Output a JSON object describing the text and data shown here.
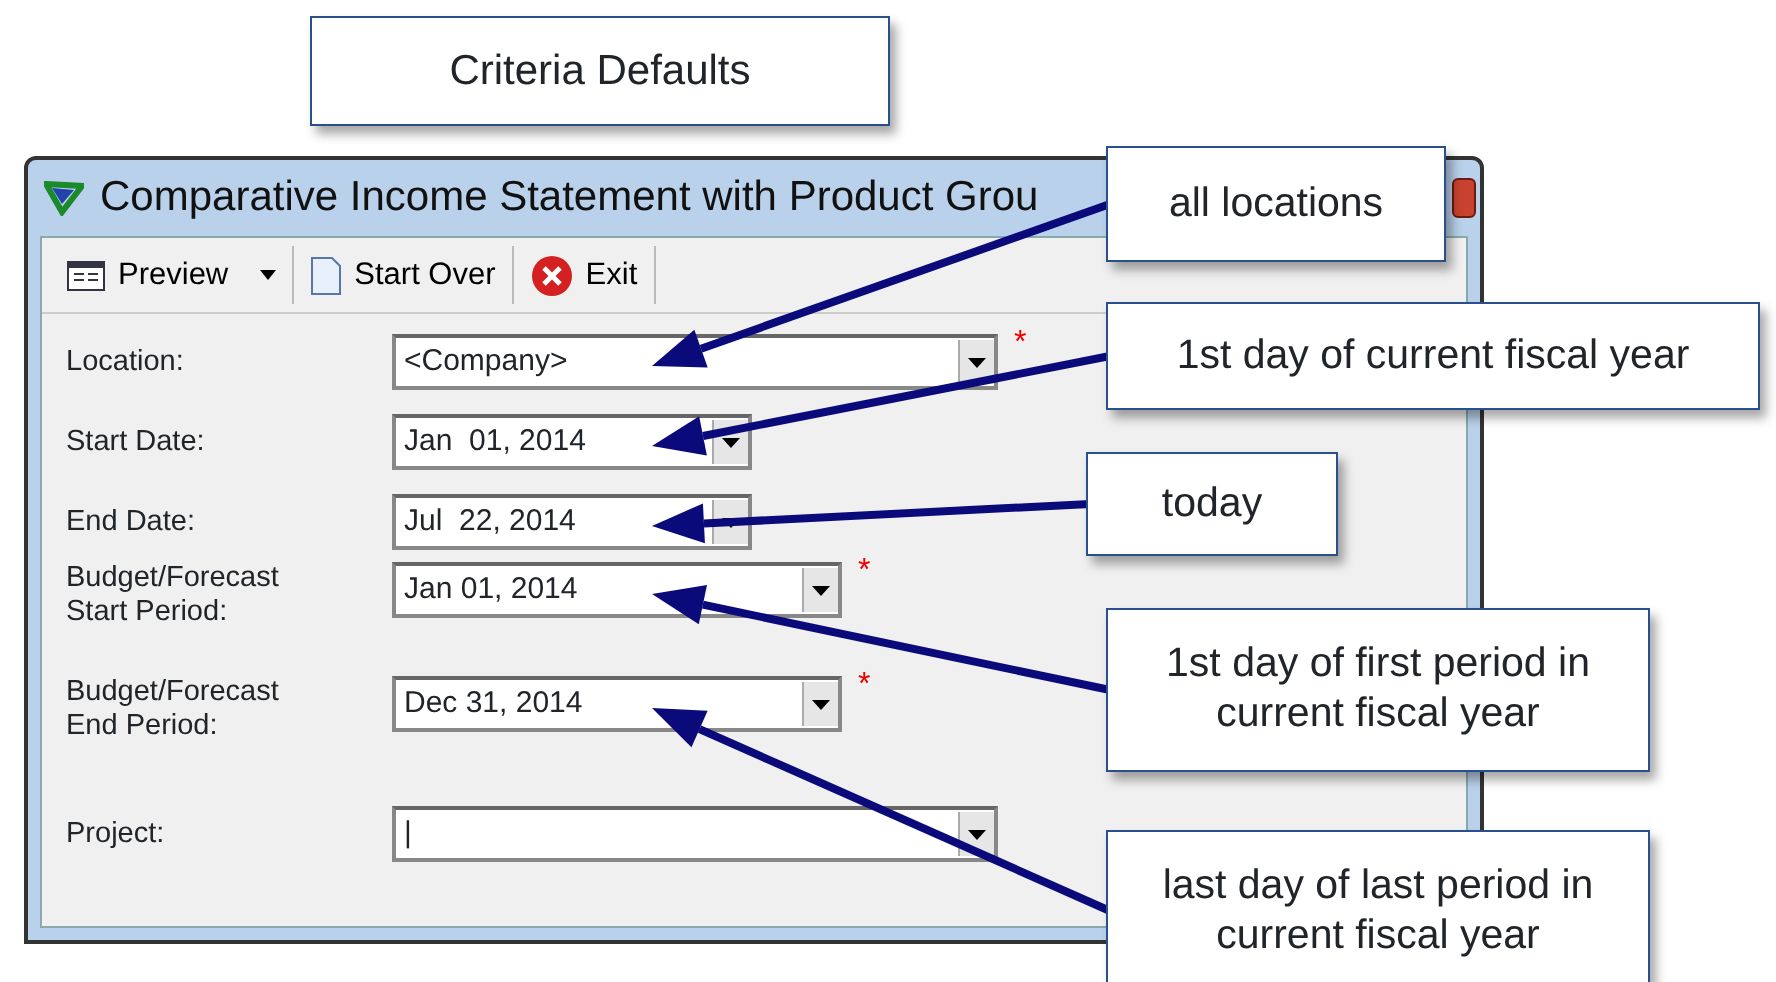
{
  "heading": {
    "text": "Criteria Defaults"
  },
  "window": {
    "title": "Comparative Income Statement with Product Grou"
  },
  "toolbar": [
    {
      "kind": "preview",
      "label": "Preview",
      "dropdown": true
    },
    {
      "kind": "start-over",
      "label": "Start Over",
      "dropdown": false
    },
    {
      "kind": "exit",
      "label": "Exit",
      "dropdown": false
    }
  ],
  "fields": [
    {
      "label": "Location:",
      "value": "<Company>",
      "kind": "wide",
      "required": true
    },
    {
      "label": "Start Date:",
      "value": "Jan  01, 2014",
      "kind": "short",
      "required": false
    },
    {
      "label": "End Date:",
      "value": "Jul  22, 2014",
      "kind": "short",
      "required": false
    },
    {
      "label": "Budget/Forecast Start Period:",
      "value": "Jan 01, 2014",
      "kind": "medium",
      "required": true
    },
    {
      "label": "Budget/Forecast End Period:",
      "value": "Dec 31, 2014",
      "kind": "medium",
      "required": true
    },
    {
      "label": "Project:",
      "value": "|",
      "kind": "wide",
      "required": false
    }
  ],
  "required_mark": "*",
  "callouts": [
    {
      "text": "all locations"
    },
    {
      "text": "1st day of current fiscal year"
    },
    {
      "text": "today"
    },
    {
      "text": "1st day of first period in current fiscal year"
    },
    {
      "text": "last day of last period in current fiscal year"
    }
  ]
}
